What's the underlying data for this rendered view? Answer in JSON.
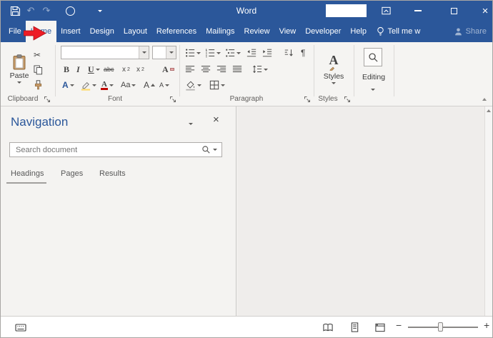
{
  "window": {
    "title": "Word"
  },
  "titlebar": {
    "undo_glyph": "↶",
    "redo_glyph": "↷",
    "close_glyph": "×",
    "search_value": ""
  },
  "tabs": {
    "items": [
      {
        "label": "File",
        "active": false
      },
      {
        "label": "Home",
        "active": true
      },
      {
        "label": "Insert",
        "active": false
      },
      {
        "label": "Design",
        "active": false
      },
      {
        "label": "Layout",
        "active": false
      },
      {
        "label": "References",
        "active": false
      },
      {
        "label": "Mailings",
        "active": false
      },
      {
        "label": "Review",
        "active": false
      },
      {
        "label": "View",
        "active": false
      },
      {
        "label": "Developer",
        "active": false
      },
      {
        "label": "Help",
        "active": false
      }
    ],
    "tell_me": "Tell me w",
    "share": "Share"
  },
  "ribbon": {
    "clipboard": {
      "label": "Clipboard",
      "paste_label": "Paste",
      "cut_glyph": "✂"
    },
    "font": {
      "label": "Font",
      "font_name_value": "",
      "font_size_value": "",
      "bold": "B",
      "italic": "I",
      "underline": "U",
      "strikethrough": "abc",
      "sub_base": "x",
      "sub_mark": "2",
      "sup_base": "x",
      "sup_mark": "2",
      "clear_format": "A",
      "text_effects": "A",
      "font_color": "A",
      "change_case": "Aa",
      "grow_font": "A",
      "shrink_font": "A"
    },
    "paragraph": {
      "label": "Paragraph",
      "pilcrow": "¶"
    },
    "styles": {
      "label": "Styles",
      "button_label": "Styles",
      "glyph": "A"
    },
    "editing": {
      "button_label": "Editing"
    }
  },
  "navigation": {
    "title": "Navigation",
    "close_glyph": "×",
    "search_placeholder": "Search document",
    "tabs": [
      {
        "label": "Headings",
        "active": true
      },
      {
        "label": "Pages",
        "active": false
      },
      {
        "label": "Results",
        "active": false
      }
    ]
  },
  "statusbar": {
    "zoom_out": "−",
    "zoom_in": "+"
  },
  "colors": {
    "titlebar": "#2b579a",
    "ribbon_bg": "#f5f4f2",
    "annotation_arrow": "#ee1c25",
    "nav_title": "#2b579a"
  },
  "icons": {
    "quick_access": [
      "save",
      "undo",
      "redo",
      "ring",
      "customize-chevron"
    ],
    "titlebar_right": [
      "ribbon-display-options",
      "minimize",
      "maximize",
      "close"
    ],
    "tell_me": "lightbulb",
    "share": "person",
    "editing_button": "magnifier",
    "status_views": [
      "read-mode",
      "print-layout",
      "web-layout"
    ]
  }
}
